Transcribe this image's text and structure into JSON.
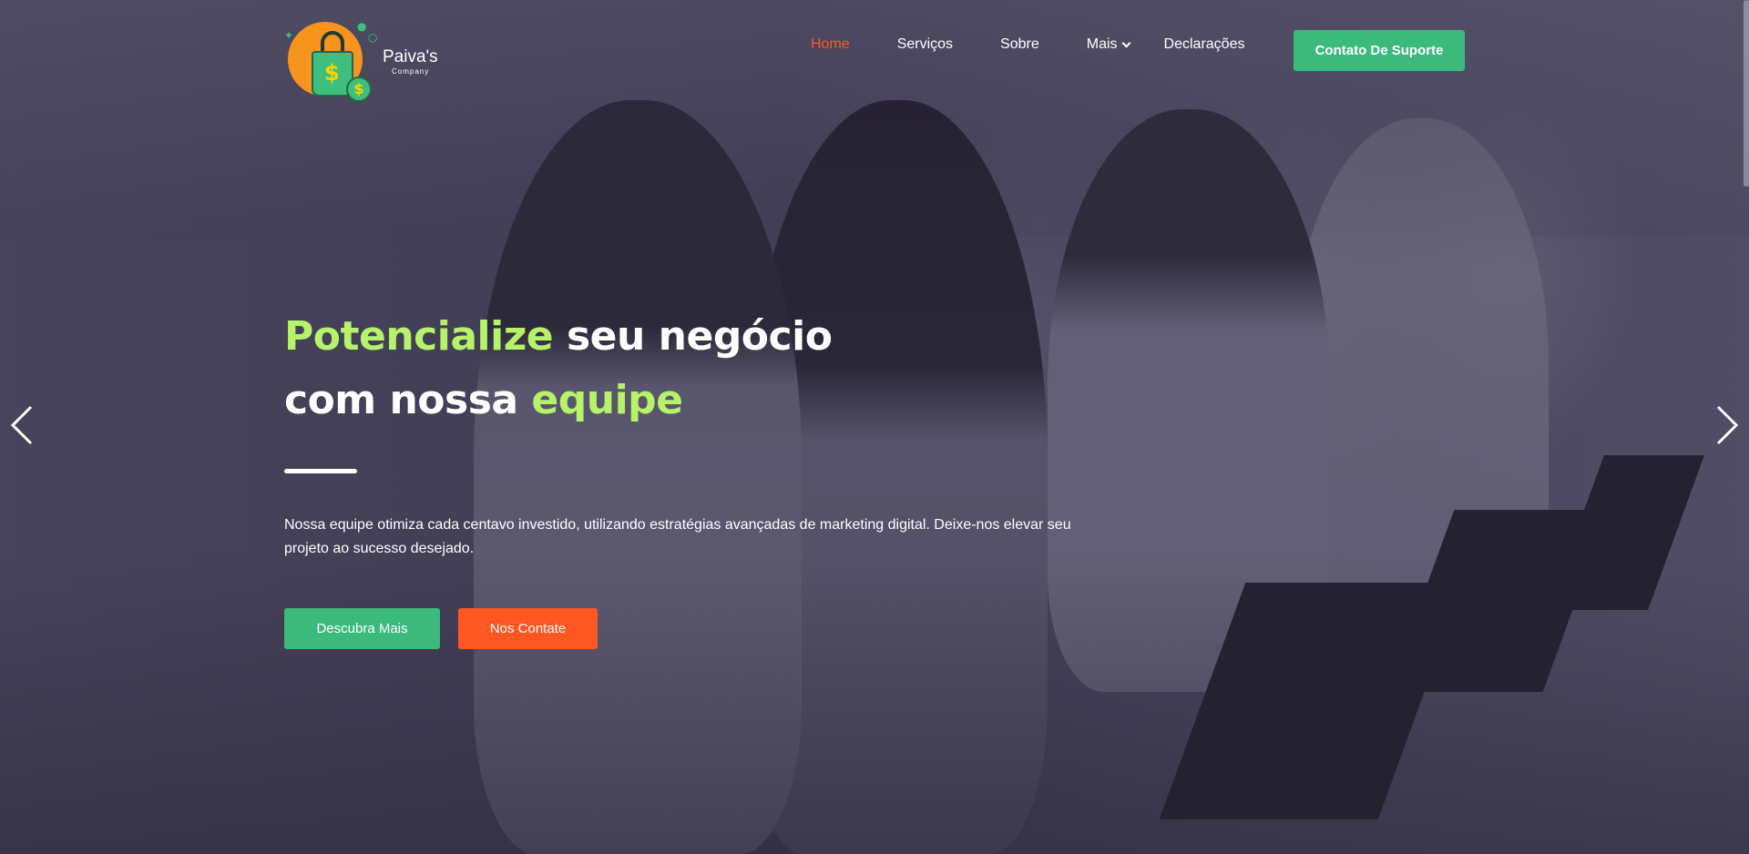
{
  "brand": {
    "name": "Paiva's",
    "sub": "Company",
    "colors": {
      "orange": "#f7941d",
      "green": "#3fbf7f",
      "gold": "#f5d400"
    }
  },
  "nav": {
    "items": [
      {
        "label": "Home",
        "active": true
      },
      {
        "label": "Serviços",
        "active": false
      },
      {
        "label": "Sobre",
        "active": false
      },
      {
        "label": "Mais",
        "active": false,
        "dropdown": true
      },
      {
        "label": "Declarações",
        "active": false
      }
    ],
    "support_button": "Contato De Suporte",
    "active_color": "#ff5722"
  },
  "hero": {
    "headline": {
      "part1_highlight": "Potencialize",
      "part1_rest": " seu negócio",
      "part2_start": "com nossa ",
      "part2_highlight": "equipe"
    },
    "description": "Nossa equipe otimiza cada centavo investido, utilizando estratégias avançadas de marketing digital. Deixe-nos elevar seu projeto ao sucesso desejado.",
    "buttons": {
      "primary": "Descubra Mais",
      "secondary": "Nos Contate"
    },
    "highlight_color": "#b6f26a",
    "primary_color": "#3bba7c",
    "secondary_color": "#ff5722"
  },
  "carousel": {
    "prev_icon": "chevron-left-icon",
    "next_icon": "chevron-right-icon"
  }
}
